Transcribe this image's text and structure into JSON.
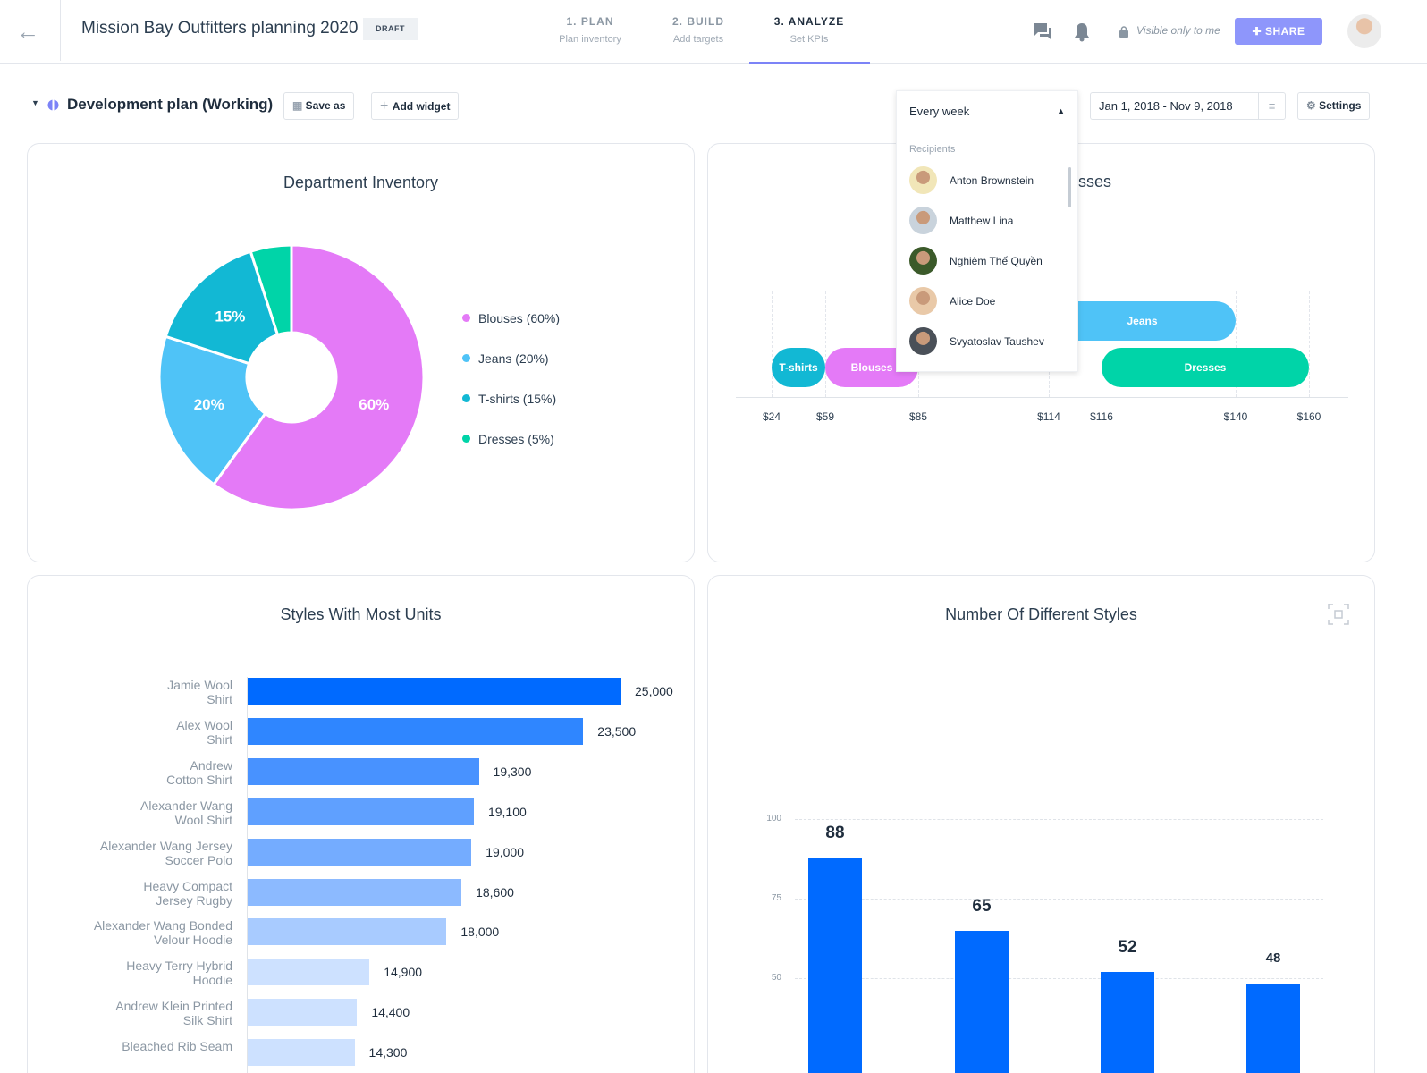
{
  "header": {
    "title": "Mission Bay Outfitters planning 2020",
    "badge": "DRAFT",
    "steps": [
      {
        "label": "1. PLAN",
        "sub": "Plan inventory"
      },
      {
        "label": "2. BUILD",
        "sub": "Add targets"
      },
      {
        "label": "3. ANALYZE",
        "sub": "Set KPIs",
        "active": true
      }
    ],
    "visibility": "Visible only to me",
    "share": "SHARE"
  },
  "toolbar": {
    "plan": "Development plan (Working)",
    "save_as": "Save as",
    "add_widget": "Add widget",
    "frequency": "Every week",
    "date_range": "Jan 1, 2018 - Nov 9, 2018",
    "settings": "Settings"
  },
  "dropdown": {
    "section": "Recipients",
    "recipients": [
      "Anton Brownstein",
      "Matthew Lina",
      "Nghiêm Thế Quyền",
      "Alice Doe",
      "Svyatoslav Taushev"
    ]
  },
  "colors": {
    "accent": "#7c83f7",
    "share": "#8e96fb",
    "blouses": "#e47af7",
    "jeans": "#4fc3f7",
    "tshirts": "#12b8d4",
    "dresses": "#00d4a8",
    "bar": "#006aff"
  },
  "chart_data": [
    {
      "type": "pie",
      "title": "Department Inventory",
      "donut": true,
      "slices": [
        {
          "label": "Blouses",
          "value": 60,
          "legend": "Blouses (60%)",
          "text": "60%",
          "color": "#e47af7"
        },
        {
          "label": "Jeans",
          "value": 20,
          "legend": "Jeans (20%)",
          "text": "20%",
          "color": "#4fc3f7"
        },
        {
          "label": "T-shirts",
          "value": 15,
          "legend": "T-shirts (15%)",
          "text": "15%",
          "color": "#12b8d4"
        },
        {
          "label": "Dresses",
          "value": 5,
          "legend": "Dresses (5%)",
          "text": "",
          "color": "#00d4a8"
        }
      ]
    },
    {
      "type": "range-bar",
      "title_visible_fragment": "sses",
      "ticks": [
        "$24",
        "$59",
        "$85",
        "$114",
        "$116",
        "$140",
        "$160"
      ],
      "ranges": [
        {
          "label": "T-shirts",
          "from": 24,
          "to": 59,
          "color": "#12b8d4"
        },
        {
          "label": "Blouses",
          "from": 59,
          "to": 85,
          "color": "#e47af7"
        },
        {
          "label": "Jeans",
          "from": 114,
          "to": 140,
          "color": "#4fc3f7"
        },
        {
          "label": "Dresses",
          "from": 116,
          "to": 160,
          "color": "#00d4a8"
        }
      ]
    },
    {
      "type": "bar",
      "orientation": "horizontal",
      "title": "Styles With Most Units",
      "xlim": [
        10000,
        25000
      ],
      "categories": [
        [
          "Jamie Wool",
          "Shirt"
        ],
        [
          "Alex Wool",
          "Shirt"
        ],
        [
          "Andrew",
          "Cotton Shirt"
        ],
        [
          "Alexander Wang",
          "Wool  Shirt"
        ],
        [
          "Alexander Wang Jersey",
          "Soccer Polo"
        ],
        [
          "Heavy Compact",
          "Jersey Rugby"
        ],
        [
          "Alexander Wang Bonded",
          "Velour Hoodie"
        ],
        [
          "Heavy Terry Hybrid",
          "Hoodie"
        ],
        [
          "Andrew Klein Printed",
          "Silk Shirt"
        ],
        [
          "Bleached Rib Seam",
          ""
        ]
      ],
      "values": [
        25000,
        23500,
        19300,
        19100,
        19000,
        18600,
        18000,
        14900,
        14400,
        14300
      ],
      "labels": [
        "25,000",
        "23,500",
        "19,300",
        "19,100",
        "19,000",
        "18,600",
        "18,000",
        "14,900",
        "14,400",
        "14,300"
      ]
    },
    {
      "type": "bar",
      "title": "Number Of Different Styles",
      "yticks": [
        "100",
        "75",
        "50"
      ],
      "values": [
        88,
        65,
        52,
        48
      ],
      "labels": [
        "88",
        "65",
        "52",
        "48"
      ]
    }
  ]
}
